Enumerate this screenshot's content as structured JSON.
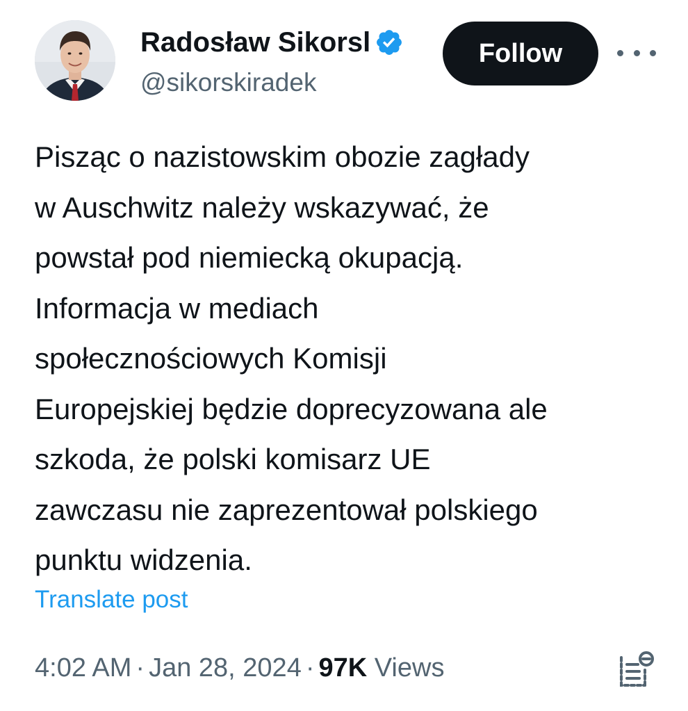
{
  "author": {
    "display_name": "Radosław Sikorsl",
    "handle": "@sikorskiradek",
    "verified_icon": "verified-badge-icon",
    "avatar_icon": "avatar"
  },
  "actions": {
    "follow_label": "Follow",
    "more_icon": "more-options-icon"
  },
  "tweet": {
    "text": "Pisząc o nazistowskim obozie zagłady\nw Auschwitz należy wskazywać, że\npowstał pod niemiecką okupacją.\nInformacja w mediach\nspołecznościowych Komisji\nEuropejskiej będzie doprecyzowana ale\nszkoda, że polski komisarz UE\nzawczasu nie zaprezentował polskiego\npunktu widzenia.",
    "translate_label": "Translate post"
  },
  "meta": {
    "time": "4:02 AM",
    "separator": "·",
    "date": "Jan 28, 2024",
    "views_count": "97K",
    "views_label": "Views",
    "analytics_icon": "analytics-icon"
  },
  "colors": {
    "text": "#0f1419",
    "secondary": "#536471",
    "link": "#1d9bf0",
    "follow_bg": "#0f1419",
    "verified": "#1d9bf0"
  }
}
